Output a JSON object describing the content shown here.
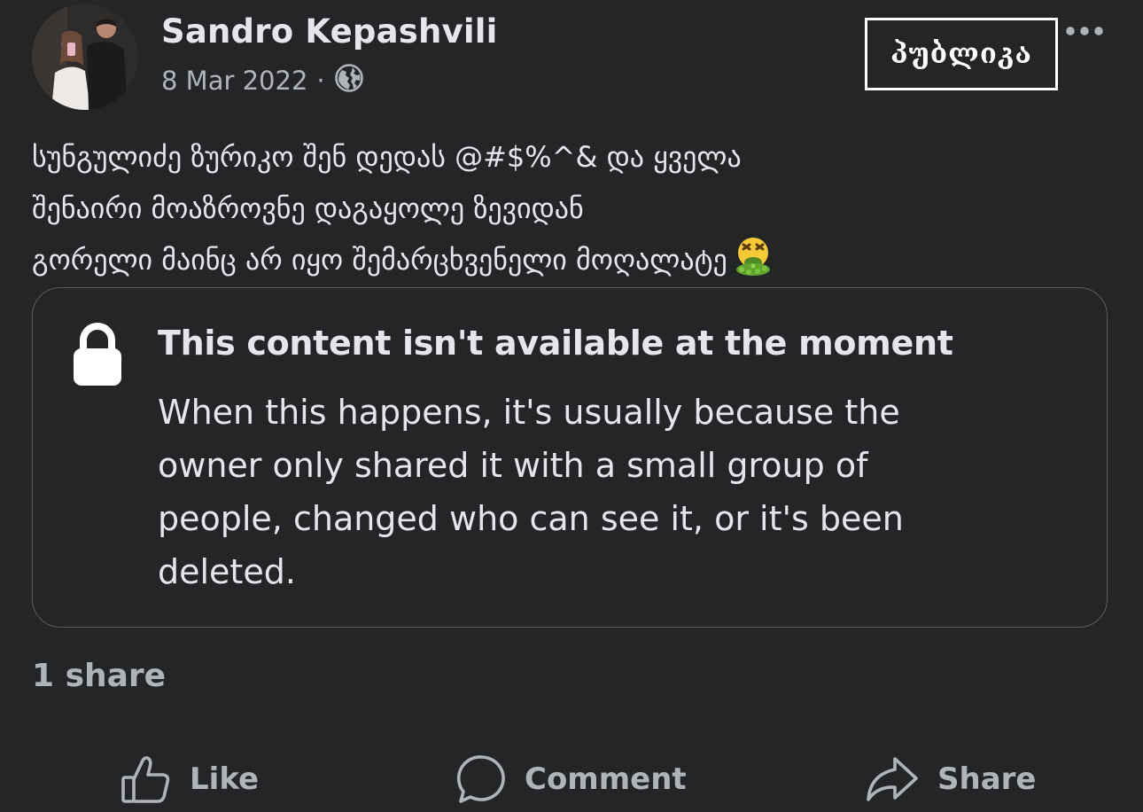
{
  "post": {
    "author": "Sandro Kepashvili",
    "date": "8 Mar 2022",
    "separator": "·",
    "audience_icon": "globe-icon",
    "stamp_text": "პუბლიკა",
    "more_icon": "more-options-icon",
    "text_lines": [
      "სუნგულიძე ზურიკო შენ დედას @#$%^&  და ყველა",
      "შენაირი მოაზროვნე დაგაყოლე ზევიდან",
      "გორელი მაინც არ იყო შემარცხვენელი მოღალატე"
    ],
    "emoji": "face-vomiting"
  },
  "shared_content": {
    "icon": "lock-icon",
    "title": "This content isn't available at the moment",
    "body_lines": [
      "When this happens, it's usually because the",
      "owner only shared it with a small group of",
      "people, changed who can see it, or it's been",
      "deleted."
    ]
  },
  "stats": {
    "shares": "1 share"
  },
  "actions": {
    "like": "Like",
    "comment": "Comment",
    "share": "Share"
  },
  "colors": {
    "background": "#242526",
    "primary_text": "#e4e6eb",
    "secondary_text": "#b0b3b8",
    "border": "#5a5c60"
  }
}
